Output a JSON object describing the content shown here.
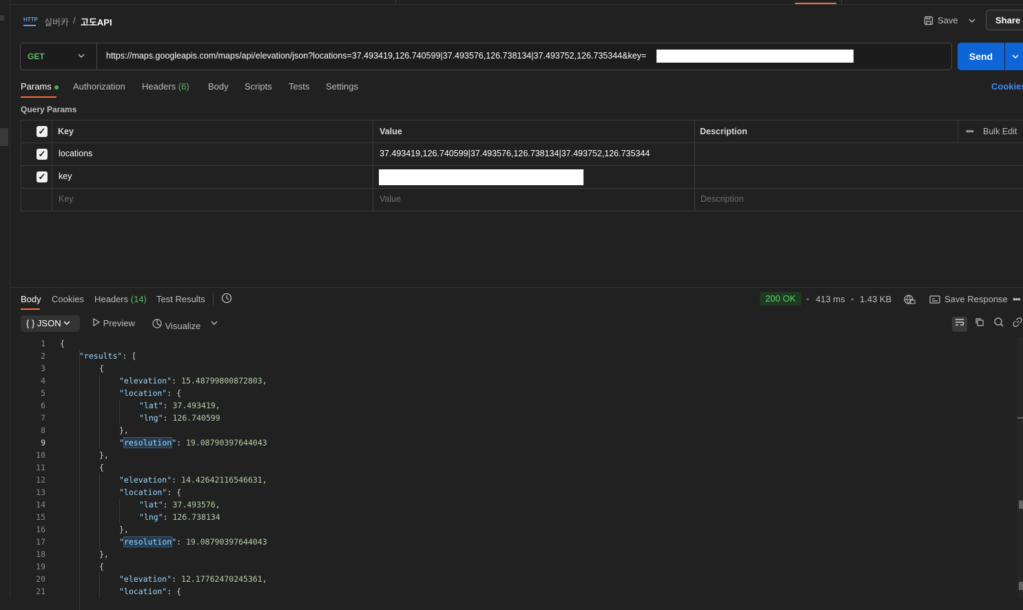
{
  "breadcrumb": {
    "icon": "HTTP",
    "parent": "실버카",
    "separator": "/",
    "current": "고도API"
  },
  "header": {
    "save_label": "Save",
    "share_label": "Share"
  },
  "request": {
    "method": "GET",
    "url": "https://maps.googleapis.com/maps/api/elevation/json?locations=37.493419,126.740599|37.493576,126.738134|37.493752,126.735344&key=",
    "send_label": "Send"
  },
  "req_tabs": {
    "params": "Params",
    "authorization": "Authorization",
    "headers": "Headers",
    "headers_count": "(6)",
    "body": "Body",
    "scripts": "Scripts",
    "tests": "Tests",
    "settings": "Settings",
    "cookies": "Cookies"
  },
  "query_params": {
    "title": "Query Params",
    "columns": {
      "key": "Key",
      "value": "Value",
      "description": "Description",
      "bulk_edit": "Bulk Edit"
    },
    "rows": [
      {
        "key": "locations",
        "value": "37.493419,126.740599|37.493576,126.738134|37.493752,126.735344",
        "checked": true
      },
      {
        "key": "key",
        "value": "",
        "checked": true
      }
    ],
    "placeholder": {
      "key": "Key",
      "value": "Value",
      "description": "Description"
    }
  },
  "response": {
    "tabs": {
      "body": "Body",
      "cookies": "Cookies",
      "headers": "Headers",
      "headers_count": "(14)",
      "test_results": "Test Results"
    },
    "status": "200 OK",
    "time": "413 ms",
    "size": "1.43 KB",
    "save_label": "Save Response",
    "format": "JSON",
    "preview": "Preview",
    "visualize": "Visualize"
  },
  "code_lines": [
    "1",
    "2",
    "3",
    "4",
    "5",
    "6",
    "7",
    "8",
    "9",
    "10",
    "11",
    "12",
    "13",
    "14",
    "15",
    "16",
    "17",
    "18",
    "19",
    "20",
    "21"
  ],
  "code": {
    "l1": "{",
    "l2k": "\"results\"",
    "l2r": ": [",
    "l3": "{",
    "l4k": "\"elevation\"",
    "l4n": "15.48799800872803",
    "l5k": "\"location\"",
    "l5r": ": {",
    "l6k": "\"lat\"",
    "l6n": "37.493419",
    "l7k": "\"lng\"",
    "l7n": "126.740599",
    "l8": "},",
    "l9q1": "\"",
    "l9h": "resolution",
    "l9q2": "\"",
    "l9n": "19.08790397644043",
    "l10": "},",
    "l11": "{",
    "l12k": "\"elevation\"",
    "l12n": "14.42642116546631",
    "l13k": "\"location\"",
    "l13r": ": {",
    "l14k": "\"lat\"",
    "l14n": "37.493576",
    "l15k": "\"lng\"",
    "l15n": "126.738134",
    "l16": "},",
    "l17q1": "\"",
    "l17h": "resolution",
    "l17q2": "\"",
    "l17n": "19.08790397644043",
    "l18": "},",
    "l19": "{",
    "l20k": "\"elevation\"",
    "l20n": "12.17762470245361",
    "l21k": "\"location\"",
    "l21r": ": {"
  }
}
